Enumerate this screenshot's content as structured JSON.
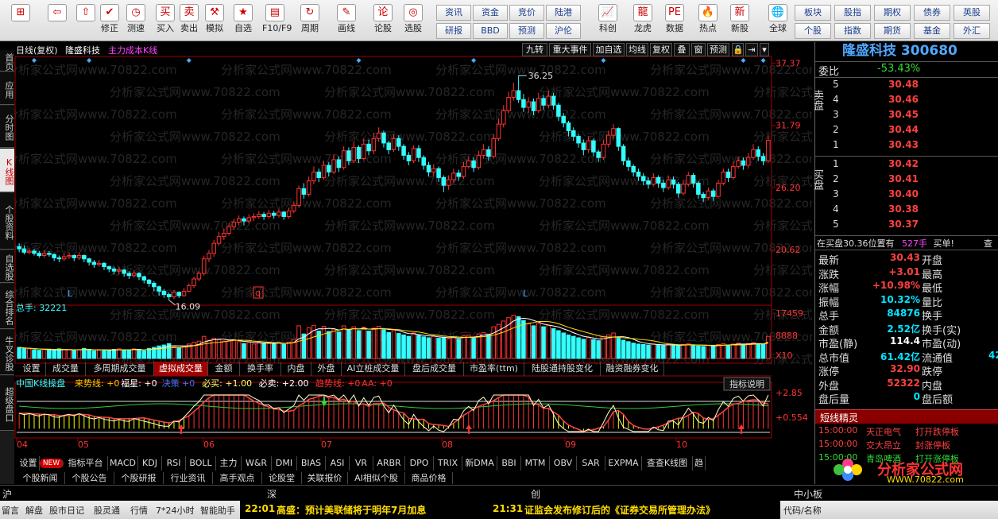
{
  "toolbar": {
    "left_buttons": [
      {
        "label": "",
        "icon": "windows-icon"
      },
      {
        "label": "",
        "icon": "back-arrow-icon"
      },
      {
        "label": "",
        "icon": "up-arrow-icon"
      },
      {
        "label": "修正",
        "icon": "correct-icon"
      },
      {
        "label": "测速",
        "icon": "clock-icon"
      },
      {
        "label": "买入",
        "icon": "buy-icon"
      },
      {
        "label": "卖出",
        "icon": "sell-icon"
      },
      {
        "label": "模拟",
        "icon": "hammer-icon"
      },
      {
        "label": "自选",
        "icon": "star-icon"
      },
      {
        "label": "F10/F9",
        "icon": "f10-icon"
      },
      {
        "label": "周期",
        "icon": "cycle-icon"
      },
      {
        "label": "画线",
        "icon": "pencil-icon"
      },
      {
        "label": "论股",
        "icon": "forum-icon"
      },
      {
        "label": "选股",
        "icon": "select-stock-icon"
      }
    ],
    "grid_buttons": [
      "资讯",
      "资金",
      "竞价",
      "陆港",
      "研报",
      "BBD",
      "预测",
      "沪伦"
    ],
    "mid_buttons": [
      {
        "label": "科创",
        "icon": "kechuang-icon"
      },
      {
        "label": "龙虎",
        "icon": "dragon-icon"
      },
      {
        "label": "数据",
        "icon": "data-icon"
      },
      {
        "label": "热点",
        "icon": "hot-icon"
      },
      {
        "label": "新股",
        "icon": "new-stock-icon"
      },
      {
        "label": "全球",
        "icon": "globe-icon"
      }
    ],
    "right_grid": [
      "板块",
      "股指",
      "期权",
      "债券",
      "英股",
      "个股",
      "指数",
      "期货",
      "基金",
      "外汇"
    ]
  },
  "left_tabs": [
    "首页",
    "应用",
    "分时图",
    "K线图",
    "个股资料",
    "自选股",
    "综合排名",
    "牛叉诊股",
    "超级盘口"
  ],
  "left_tab_active": 3,
  "kline_header": {
    "period": "日线(复权)",
    "stock_name": "隆盛科技",
    "indicator": "主力成本K线",
    "buttons": [
      "九转",
      "重大事件",
      "加自选",
      "均线",
      "复权",
      "叠",
      "窗",
      "预测",
      "🔒",
      "⇥",
      "▾"
    ]
  },
  "watermark": "分析家公式网www.70822.com",
  "chart_data": {
    "type": "candlestick",
    "price_axis": [
      "37.37",
      "31.79",
      "26.20",
      "20.62"
    ],
    "price_range": [
      16.0,
      37.9
    ],
    "high_label": "36.25",
    "low_label": "16.09",
    "volume_label": "总手: 32221",
    "volume_axis": [
      "17459",
      "8888",
      "X10"
    ],
    "months": [
      "04",
      "05",
      "06",
      "07",
      "08",
      "09",
      "10"
    ],
    "signal_labels": [
      "L",
      "L"
    ],
    "q_marker": "q",
    "candles": [
      [
        20.9,
        20.7,
        21.2,
        20.4
      ],
      [
        20.7,
        20.4,
        21.0,
        20.2
      ],
      [
        20.4,
        20.5,
        20.8,
        20.2
      ],
      [
        20.5,
        20.3,
        20.7,
        20.1
      ],
      [
        20.3,
        20.1,
        20.5,
        19.9
      ],
      [
        20.1,
        20.3,
        20.6,
        19.9
      ],
      [
        20.3,
        20.2,
        20.5,
        20.0
      ],
      [
        20.2,
        19.9,
        20.3,
        19.6
      ],
      [
        19.9,
        19.8,
        20.1,
        19.5
      ],
      [
        19.8,
        20.0,
        20.3,
        19.6
      ],
      [
        20.0,
        20.1,
        20.4,
        19.8
      ],
      [
        20.1,
        19.9,
        20.2,
        19.6
      ],
      [
        19.9,
        20.1,
        20.4,
        19.7
      ],
      [
        20.1,
        19.8,
        20.2,
        19.5
      ],
      [
        19.8,
        19.5,
        19.9,
        19.2
      ],
      [
        19.5,
        19.3,
        19.7,
        19.0
      ],
      [
        19.3,
        19.4,
        19.7,
        19.1
      ],
      [
        19.4,
        19.1,
        19.5,
        18.8
      ],
      [
        19.1,
        18.9,
        19.2,
        18.6
      ],
      [
        18.9,
        18.7,
        19.1,
        18.4
      ],
      [
        18.7,
        18.8,
        19.1,
        18.4
      ],
      [
        18.8,
        18.5,
        18.9,
        18.2
      ],
      [
        18.5,
        18.3,
        18.7,
        18.0
      ],
      [
        18.3,
        18.5,
        18.8,
        18.1
      ],
      [
        18.5,
        18.2,
        18.6,
        17.9
      ],
      [
        18.2,
        17.9,
        18.3,
        17.6
      ],
      [
        17.9,
        17.6,
        18.0,
        17.3
      ],
      [
        17.6,
        17.3,
        17.8,
        16.9
      ],
      [
        17.3,
        16.9,
        17.4,
        16.5
      ],
      [
        16.9,
        16.6,
        17.1,
        16.3
      ],
      [
        16.6,
        16.4,
        16.8,
        16.09
      ],
      [
        16.4,
        16.8,
        17.0,
        16.2
      ],
      [
        16.8,
        16.5,
        16.9,
        16.3
      ],
      [
        16.5,
        16.9,
        17.2,
        16.4
      ],
      [
        16.9,
        17.4,
        17.6,
        16.8
      ],
      [
        17.4,
        18.0,
        18.2,
        17.2
      ],
      [
        18.0,
        18.5,
        18.7,
        17.8
      ],
      [
        18.5,
        19.8,
        20.1,
        18.3
      ],
      [
        19.8,
        20.3,
        20.6,
        19.5
      ],
      [
        20.3,
        21.2,
        21.5,
        20.0
      ],
      [
        21.2,
        21.8,
        22.2,
        21.0
      ],
      [
        21.8,
        22.1,
        22.5,
        21.5
      ],
      [
        22.1,
        22.7,
        23.0,
        21.9
      ],
      [
        22.7,
        23.1,
        23.4,
        22.4
      ],
      [
        23.1,
        23.4,
        23.7,
        22.8
      ],
      [
        23.4,
        23.2,
        23.6,
        22.8
      ],
      [
        23.2,
        23.5,
        23.8,
        23.0
      ],
      [
        23.5,
        23.6,
        23.9,
        23.2
      ],
      [
        23.6,
        23.8,
        24.1,
        23.4
      ],
      [
        23.8,
        23.6,
        24.0,
        23.3
      ],
      [
        23.6,
        23.9,
        24.2,
        23.4
      ],
      [
        23.9,
        23.7,
        24.1,
        23.4
      ],
      [
        23.7,
        24.0,
        24.3,
        23.5
      ],
      [
        24.0,
        23.6,
        24.1,
        23.3
      ],
      [
        23.6,
        24.1,
        24.4,
        23.4
      ],
      [
        24.1,
        24.6,
        24.9,
        23.9
      ],
      [
        24.6,
        26.1,
        26.4,
        24.4
      ],
      [
        26.1,
        25.6,
        26.6,
        25.2
      ],
      [
        25.6,
        26.8,
        27.2,
        25.4
      ],
      [
        26.8,
        27.6,
        28.1,
        26.5
      ],
      [
        27.6,
        27.1,
        27.9,
        26.7
      ],
      [
        27.1,
        28.2,
        28.6,
        26.9
      ],
      [
        28.2,
        27.6,
        28.5,
        27.2
      ],
      [
        27.6,
        28.7,
        29.2,
        27.4
      ],
      [
        28.7,
        28.0,
        29.0,
        27.6
      ],
      [
        28.0,
        29.5,
        29.9,
        27.8
      ],
      [
        29.5,
        28.6,
        29.8,
        28.2
      ],
      [
        28.6,
        29.8,
        30.3,
        28.4
      ],
      [
        29.8,
        28.8,
        30.0,
        28.4
      ],
      [
        28.8,
        30.1,
        30.6,
        28.6
      ],
      [
        30.1,
        29.5,
        30.5,
        29.1
      ],
      [
        29.5,
        30.6,
        31.1,
        29.2
      ],
      [
        30.6,
        31.1,
        31.6,
        30.3
      ],
      [
        31.1,
        30.2,
        31.3,
        29.8
      ],
      [
        30.2,
        29.6,
        30.4,
        29.2
      ],
      [
        29.6,
        30.6,
        31.0,
        29.4
      ],
      [
        30.6,
        29.9,
        30.9,
        29.5
      ],
      [
        29.9,
        29.1,
        30.1,
        28.7
      ],
      [
        29.1,
        28.6,
        29.4,
        28.2
      ],
      [
        28.6,
        29.7,
        30.0,
        28.4
      ],
      [
        29.7,
        28.9,
        30.0,
        28.5
      ],
      [
        28.9,
        28.2,
        29.1,
        27.8
      ],
      [
        28.2,
        27.6,
        28.5,
        27.2
      ],
      [
        27.6,
        27.9,
        28.3,
        27.2
      ],
      [
        27.9,
        27.1,
        28.1,
        26.7
      ],
      [
        27.1,
        26.4,
        27.3,
        25.8
      ],
      [
        26.4,
        26.9,
        27.3,
        26.0
      ],
      [
        26.9,
        27.5,
        27.9,
        26.6
      ],
      [
        27.5,
        27.2,
        27.8,
        26.8
      ],
      [
        27.2,
        28.1,
        28.5,
        27.0
      ],
      [
        28.1,
        28.6,
        29.0,
        27.9
      ],
      [
        28.6,
        28.0,
        28.9,
        27.6
      ],
      [
        28.0,
        29.1,
        29.5,
        27.8
      ],
      [
        29.1,
        29.6,
        30.1,
        28.8
      ],
      [
        29.6,
        29.0,
        29.9,
        28.6
      ],
      [
        29.0,
        30.6,
        31.0,
        28.8
      ],
      [
        30.6,
        31.9,
        32.4,
        30.4
      ],
      [
        31.9,
        33.1,
        33.6,
        31.6
      ],
      [
        33.1,
        34.3,
        34.8,
        32.9
      ],
      [
        34.3,
        34.9,
        35.6,
        34.0
      ],
      [
        34.9,
        34.1,
        36.25,
        33.8
      ],
      [
        34.1,
        33.4,
        34.6,
        33.0
      ],
      [
        33.4,
        33.9,
        34.3,
        32.9
      ],
      [
        33.9,
        33.1,
        34.2,
        32.7
      ],
      [
        33.1,
        34.2,
        34.7,
        32.9
      ],
      [
        34.2,
        33.6,
        34.5,
        33.2
      ],
      [
        33.6,
        34.4,
        34.9,
        33.3
      ],
      [
        34.4,
        33.6,
        34.7,
        33.2
      ],
      [
        33.6,
        32.6,
        33.8,
        32.2
      ],
      [
        32.6,
        32.0,
        32.9,
        31.6
      ],
      [
        32.0,
        31.3,
        32.2,
        30.8
      ],
      [
        31.3,
        30.8,
        31.6,
        30.4
      ],
      [
        30.8,
        30.2,
        31.0,
        29.8
      ],
      [
        30.2,
        29.6,
        30.5,
        29.1
      ],
      [
        29.6,
        30.4,
        30.8,
        29.3
      ],
      [
        30.4,
        29.4,
        30.6,
        29.0
      ],
      [
        29.4,
        28.9,
        29.6,
        28.5
      ],
      [
        28.9,
        30.1,
        30.5,
        28.7
      ],
      [
        30.1,
        30.9,
        31.3,
        29.8
      ],
      [
        30.9,
        31.5,
        31.9,
        30.6
      ],
      [
        31.5,
        29.9,
        31.6,
        29.5
      ],
      [
        29.9,
        28.6,
        30.1,
        28.2
      ],
      [
        28.6,
        28.1,
        28.9,
        27.7
      ],
      [
        28.1,
        27.6,
        28.3,
        27.2
      ],
      [
        27.6,
        27.2,
        27.9,
        26.8
      ],
      [
        27.2,
        26.8,
        27.5,
        26.4
      ],
      [
        26.8,
        26.5,
        27.1,
        26.1
      ],
      [
        26.5,
        27.1,
        27.5,
        26.3
      ],
      [
        27.1,
        26.6,
        27.3,
        26.2
      ],
      [
        26.6,
        26.2,
        26.9,
        25.8
      ],
      [
        26.2,
        26.9,
        27.3,
        26.0
      ],
      [
        26.9,
        26.5,
        27.2,
        26.1
      ],
      [
        26.5,
        25.7,
        26.7,
        25.3
      ],
      [
        25.7,
        26.5,
        26.9,
        25.5
      ],
      [
        26.5,
        27.3,
        27.6,
        26.3
      ],
      [
        27.3,
        26.6,
        27.5,
        26.2
      ],
      [
        26.6,
        25.6,
        26.8,
        25.2
      ],
      [
        25.6,
        25.3,
        25.8,
        24.9
      ],
      [
        25.3,
        25.9,
        26.2,
        25.1
      ],
      [
        25.9,
        25.4,
        26.1,
        25.0
      ],
      [
        25.4,
        26.6,
        26.9,
        25.3
      ],
      [
        26.6,
        27.6,
        27.9,
        26.4
      ],
      [
        27.6,
        27.1,
        27.9,
        26.7
      ],
      [
        27.1,
        28.1,
        28.5,
        26.9
      ],
      [
        28.1,
        28.6,
        29.0,
        27.9
      ],
      [
        28.6,
        28.2,
        28.9,
        27.8
      ],
      [
        28.2,
        28.9,
        29.3,
        27.9
      ],
      [
        28.9,
        29.6,
        30.1,
        28.7
      ],
      [
        29.6,
        29.0,
        29.9,
        28.6
      ],
      [
        29.0,
        28.6,
        29.3,
        28.2
      ],
      [
        28.6,
        30.43,
        30.8,
        28.4
      ]
    ],
    "volumes": [
      2.3,
      2.1,
      2.0,
      1.8,
      1.7,
      1.9,
      1.8,
      1.6,
      2.0,
      1.8,
      1.9,
      1.7,
      1.8,
      2.1,
      1.9,
      1.6,
      1.7,
      1.8,
      1.6,
      1.9,
      2.0,
      1.8,
      1.7,
      2.0,
      1.9,
      1.6,
      2.1,
      2.3,
      2.6,
      2.8,
      3.1,
      2.4,
      2.2,
      2.5,
      3.0,
      3.4,
      3.6,
      4.6,
      3.8,
      4.2,
      3.9,
      3.6,
      3.7,
      3.9,
      3.5,
      3.1,
      3.3,
      3.0,
      3.4,
      3.2,
      3.1,
      3.0,
      3.3,
      2.9,
      3.4,
      4.0,
      6.8,
      5.1,
      6.4,
      6.9,
      5.7,
      6.7,
      5.6,
      6.1,
      5.5,
      6.8,
      5.9,
      6.6,
      5.8,
      6.5,
      5.7,
      6.3,
      6.7,
      6.0,
      5.4,
      5.8,
      5.2,
      4.9,
      4.6,
      5.3,
      4.8,
      4.5,
      4.3,
      4.6,
      4.2,
      4.4,
      4.1,
      4.5,
      4.0,
      4.7,
      4.8,
      4.3,
      5.1,
      5.4,
      5.0,
      6.6,
      7.1,
      7.8,
      8.5,
      9.0,
      8.7,
      7.9,
      7.2,
      6.8,
      7.3,
      6.6,
      6.9,
      6.2,
      5.8,
      5.3,
      4.9,
      4.6,
      4.3,
      4.0,
      4.4,
      3.9,
      3.7,
      4.5,
      4.9,
      5.3,
      4.2,
      3.8,
      3.5,
      3.2,
      3.0,
      2.9,
      2.8,
      3.0,
      2.8,
      2.7,
      2.9,
      2.8,
      2.6,
      2.9,
      3.1,
      2.8,
      2.6,
      2.5,
      2.7,
      2.6,
      2.9,
      3.1,
      2.8,
      3.0,
      3.2,
      2.9,
      3.1,
      3.3,
      3.0,
      2.9,
      4.6
    ],
    "indicator_axis": [
      "+2.85",
      "+0.554"
    ],
    "indicator_title": "中国K线操盘",
    "indicator_parts": [
      {
        "text": "来势线: +0",
        "color": "#ffcc00"
      },
      {
        "text": "福星: +0",
        "color": "#ffffff"
      },
      {
        "text": "决策",
        "color": "#3377ff"
      },
      {
        "text": "+0",
        "color": "#3377ff"
      },
      {
        "text": "必买: +1.00",
        "color": "#ffff66"
      },
      {
        "text": "必卖: +2.00",
        "color": "#ffffff"
      },
      {
        "text": "趋势线: +0",
        "color": "#ff3333"
      },
      {
        "text": "AA: +0",
        "color": "#ff3333"
      }
    ],
    "indicator_button": "指标说明"
  },
  "indicator_tabs": [
    "设置",
    "成交量",
    "多周期成交量",
    "虚拟成交量",
    "金额",
    "换手率",
    "内盘",
    "外盘",
    "AI立桩成交量",
    "盘后成交量",
    "市盈率(ttm)",
    "陆股通持股变化",
    "融资融券变化"
  ],
  "indicator_tab_active": 3,
  "bottom_tabs": [
    "设置",
    "NEW",
    "指标平台",
    "MACD",
    "KDJ",
    "RSI",
    "BOLL",
    "主力",
    "W&R",
    "DMI",
    "BIAS",
    "ASI",
    "VR",
    "ARBR",
    "DPO",
    "TRIX",
    "新DMA",
    "BBI",
    "MTM",
    "OBV",
    "SAR",
    "EXPMA",
    "查查K线图",
    "趋"
  ],
  "news_tabs": [
    "个股新闻",
    "个股公告",
    "个股研报",
    "行业资讯",
    "高手观点",
    "论股堂",
    "关联报价",
    "AI相似个股",
    "商品价格"
  ],
  "quote": {
    "title": "隆盛科技 300680",
    "weibi_label": "委比",
    "weibi_value": "-53.43%",
    "sell_label": "卖盘",
    "buy_label": "买盘",
    "sell": [
      {
        "lv": "5",
        "p": "30.48"
      },
      {
        "lv": "4",
        "p": "30.46"
      },
      {
        "lv": "3",
        "p": "30.45"
      },
      {
        "lv": "2",
        "p": "30.44"
      },
      {
        "lv": "1",
        "p": "30.43"
      }
    ],
    "buy": [
      {
        "lv": "1",
        "p": "30.42"
      },
      {
        "lv": "2",
        "p": "30.41"
      },
      {
        "lv": "3",
        "p": "30.40"
      },
      {
        "lv": "4",
        "p": "30.38"
      },
      {
        "lv": "5",
        "p": "30.37"
      }
    ],
    "notice": "在买盘30.36位置有",
    "notice_qty": "527手",
    "notice_tail": "买单!",
    "notice_btn": "查",
    "rows": [
      {
        "l": "最新",
        "v": "30.43",
        "c": "#ff4040",
        "r": "开盘"
      },
      {
        "l": "涨跌",
        "v": "+3.01",
        "c": "#ff4040",
        "r": "最高"
      },
      {
        "l": "涨幅",
        "v": "+10.98%",
        "c": "#ff4040",
        "r": "最低"
      },
      {
        "l": "振幅",
        "v": "10.32%",
        "c": "#00e5ff",
        "r": "量比"
      },
      {
        "l": "总手",
        "v": "84876",
        "c": "#00e5ff",
        "r": "换手"
      },
      {
        "l": "金额",
        "v": "2.52亿",
        "c": "#00e5ff",
        "r": "换手(实)"
      },
      {
        "l": "市盈(静)",
        "v": "114.4",
        "c": "#ffffff",
        "r": "市盈(动)"
      },
      {
        "l": "总市值",
        "v": "61.42亿",
        "c": "#00e5ff",
        "r": "流通值"
      },
      {
        "l": "涨停",
        "v": "32.90",
        "c": "#ff4040",
        "r": "跌停"
      },
      {
        "l": "外盘",
        "v": "52322",
        "c": "#ff4040",
        "r": "内盘"
      },
      {
        "l": "盘后量",
        "v": "0",
        "c": "#00e5ff",
        "r": "盘后额"
      }
    ],
    "rowvals": [
      "",
      "",
      "",
      "",
      "",
      "",
      "",
      "42",
      "",
      "",
      ""
    ],
    "short_title": "短线精灵",
    "short_list": [
      {
        "t": "15:00:00",
        "s": "天正电气",
        "e": "打开跌停板",
        "c": "#ff4040"
      },
      {
        "t": "15:00:00",
        "s": "交大昂立",
        "e": "封涨停板",
        "c": "#ff4040"
      },
      {
        "t": "15:00:00",
        "s": "青岛啤酒",
        "e": "打开涨停板",
        "c": "#33dd33"
      }
    ],
    "ad_text": "分析家公式网",
    "ad_url": "WWW.70822.com"
  },
  "indexbar": {
    "sh": "沪",
    "sz": "深",
    "cy": "创",
    "zx": "中小板"
  },
  "statusbar": {
    "items": [
      "留言",
      "解盘",
      "股市日记",
      "股灵通",
      "行情",
      "7*24小时",
      "智能助手"
    ],
    "news1_time": "22:01",
    "news1": "高盛：预计美联储将于明年7月加息",
    "news2_time": "21:31",
    "news2": "证监会发布修订后的《证券交易所管理办法》",
    "right": "代码/名称"
  }
}
